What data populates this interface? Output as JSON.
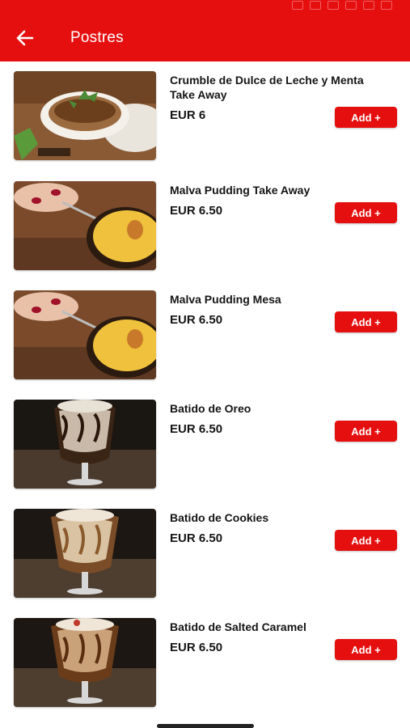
{
  "status_bar": {
    "time": "",
    "icons": [
      "wifi-icon",
      "mute-icon",
      "data-icon",
      "notification-icon",
      "signal-icon",
      "battery-icon"
    ]
  },
  "header": {
    "title": "Postres",
    "back_icon": "arrow-left-icon",
    "background": "#e60f0f"
  },
  "items": [
    {
      "name": "Crumble de Dulce de Leche y Menta  Take Away",
      "price": "EUR 6",
      "button": "Add +",
      "image": "crumble-dessert-image"
    },
    {
      "name": "Malva Pudding Take Away",
      "price": "EUR 6.50",
      "button": "Add +",
      "image": "malva-pudding-image"
    },
    {
      "name": "Malva Pudding Mesa",
      "price": "EUR 6.50",
      "button": "Add +",
      "image": "malva-pudding-image"
    },
    {
      "name": "Batido de Oreo",
      "price": "EUR 6.50",
      "button": "Add +",
      "image": "oreo-milkshake-image"
    },
    {
      "name": "Batido de Cookies",
      "price": "EUR 6.50",
      "button": "Add +",
      "image": "cookies-milkshake-image"
    },
    {
      "name": "Batido de Salted Caramel",
      "price": "EUR 6.50",
      "button": "Add +",
      "image": "salted-caramel-milkshake-image"
    }
  ]
}
